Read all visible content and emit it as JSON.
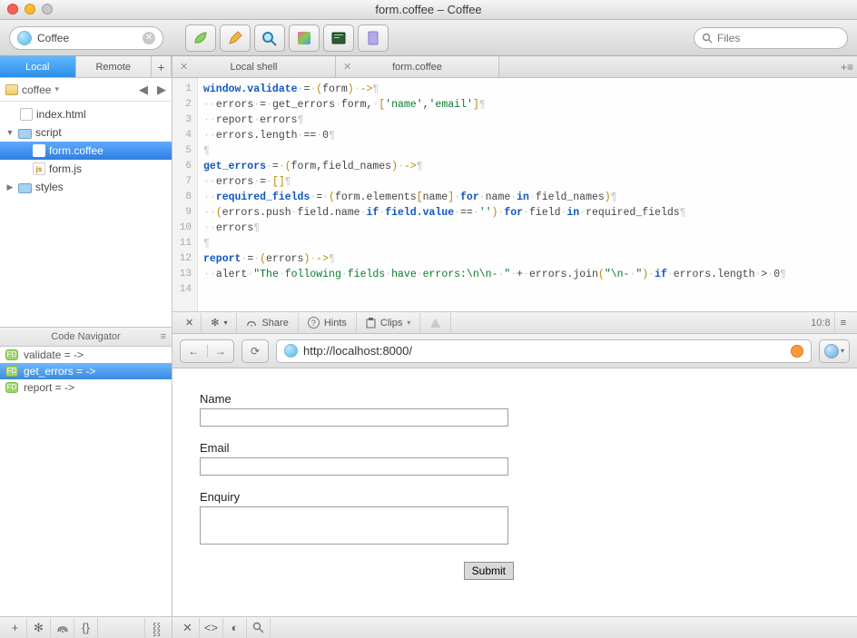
{
  "window": {
    "title": "form.coffee – Coffee"
  },
  "toolbar": {
    "site_label": "Coffee",
    "search_placeholder": "Files"
  },
  "sidebar": {
    "tabs": {
      "local": "Local",
      "remote": "Remote"
    },
    "site": "coffee",
    "tree": {
      "index": "index.html",
      "script": "script",
      "formcoffee": "form.coffee",
      "formjs": "form.js",
      "styles": "styles"
    },
    "nav_header": "Code Navigator",
    "nav": {
      "validate": "validate =  ->",
      "get_errors": "get_errors =  ->",
      "report": "report =  ->"
    }
  },
  "editor_tabs": {
    "shell": "Local shell",
    "file": "form.coffee"
  },
  "code": {
    "lines": [
      "window.validate·=·(form)·->¶",
      "··errors·=·get_errors·form,·['name','email']¶",
      "··report·errors¶",
      "··errors.length·==·0¶",
      "¶",
      "get_errors·=·(form,field_names)·->¶",
      "··errors·=·[]¶",
      "··required_fields·=·(form.elements[name]·for·name·in·field_names)¶",
      "··(errors.push·field.name·if·field.value·==·'')·for·field·in·required_fields¶",
      "··errors¶",
      "¶",
      "report·=·(errors)·->¶",
      "··alert·\"The·following·fields·have·errors:\\n\\n-·\"·+·errors.join(\"\\n-·\")·if·errors.length·>·0¶",
      ""
    ]
  },
  "midbar": {
    "share": "Share",
    "hints": "Hints",
    "clips": "Clips",
    "pos": "10:8"
  },
  "preview": {
    "url": "http://localhost:8000/",
    "form": {
      "name_label": "Name",
      "email_label": "Email",
      "enquiry_label": "Enquiry",
      "submit": "Submit"
    }
  }
}
